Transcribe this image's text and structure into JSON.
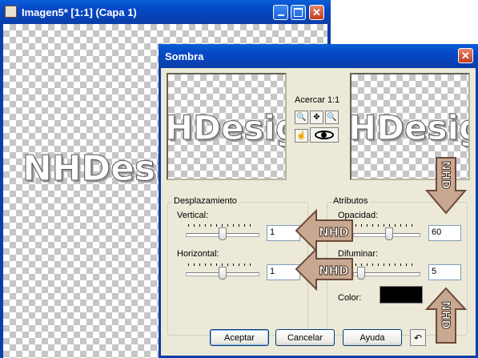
{
  "image_window": {
    "title": "Imagen5* [1:1] (Capa 1)",
    "canvas_text": "NHDesi"
  },
  "dialog": {
    "title": "Sombra",
    "zoom_label": "Acercar 1:1",
    "preview_text": "HDesig",
    "offset_group": {
      "legend": "Desplazamiento",
      "vertical_label": "Vertical:",
      "vertical_value": "1",
      "horizontal_label": "Horizontal:",
      "horizontal_value": "1"
    },
    "attributes_group": {
      "legend": "Atributos",
      "opacity_label": "Opacidad:",
      "opacity_value": "60",
      "blur_label": "Difuminar:",
      "blur_value": "5",
      "color_label": "Color:",
      "color_value": "#000000"
    },
    "buttons": {
      "ok": "Aceptar",
      "cancel": "Cancelar",
      "help": "Ayuda"
    }
  },
  "watermark": {
    "arrow_text": "NHD",
    "arrow_color": "#c8a890",
    "arrow_outline": "#6b4a3a"
  }
}
